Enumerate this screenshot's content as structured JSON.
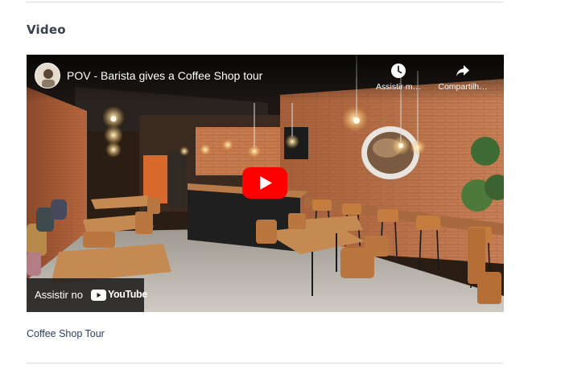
{
  "section": {
    "title": "Video"
  },
  "player": {
    "video_title": "POV - Barista gives a Coffee Shop tour",
    "watch_later_label": "Assistir m…",
    "share_label": "Compartilh…",
    "watch_on_label": "Assistir no",
    "youtube_wordmark": "YouTube",
    "play_color": "#ff0000"
  },
  "caption": {
    "text": "Coffee Shop Tour"
  },
  "icons": {
    "avatar": "channel-avatar",
    "watch_later": "clock-icon",
    "share": "share-arrow-icon",
    "play": "play-icon",
    "youtube": "youtube-logo-icon"
  }
}
